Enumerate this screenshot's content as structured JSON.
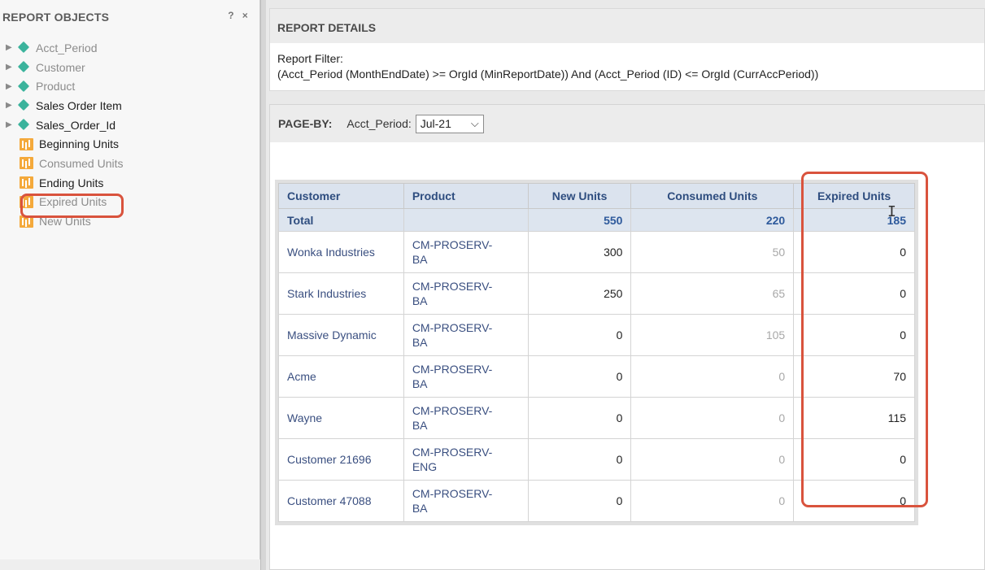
{
  "left_panel": {
    "title": "REPORT OBJECTS",
    "help_label": "?",
    "close_label": "×",
    "attributes": [
      {
        "label": "Acct_Period",
        "style": "light"
      },
      {
        "label": "Customer",
        "style": "light"
      },
      {
        "label": "Product",
        "style": "light"
      },
      {
        "label": "Sales Order Item",
        "style": "dark"
      },
      {
        "label": "Sales_Order_Id",
        "style": "dark"
      }
    ],
    "metrics": [
      {
        "label": "Beginning Units",
        "style": "dark"
      },
      {
        "label": "Consumed Units",
        "style": "light"
      },
      {
        "label": "Ending Units",
        "style": "dark"
      },
      {
        "label": "Expired Units",
        "style": "light"
      },
      {
        "label": "New Units",
        "style": "light"
      }
    ]
  },
  "details": {
    "title": "REPORT DETAILS",
    "filter_label": "Report Filter:",
    "filter_text": "(Acct_Period (MonthEndDate) >= OrgId (MinReportDate)) And (Acct_Period (ID) <= OrgId (CurrAccPeriod))"
  },
  "pageby": {
    "label": "PAGE-BY:",
    "field": "Acct_Period:",
    "selected": "Jul-21"
  },
  "grid": {
    "headers": [
      "Customer",
      "Product",
      "New Units",
      "Consumed Units",
      "Expired Units"
    ],
    "total": {
      "label": "Total",
      "new_units": "550",
      "consumed_units": "220",
      "expired_units": "185"
    },
    "rows": [
      {
        "customer": "Wonka Industries",
        "product_line1": "CM-PROSERV-",
        "product_line2": "BA",
        "new_units": "300",
        "consumed_units": "50",
        "expired_units": "0"
      },
      {
        "customer": "Stark Industries",
        "product_line1": "CM-PROSERV-",
        "product_line2": "BA",
        "new_units": "250",
        "consumed_units": "65",
        "expired_units": "0"
      },
      {
        "customer": "Massive Dynamic",
        "product_line1": "CM-PROSERV-",
        "product_line2": "BA",
        "new_units": "0",
        "consumed_units": "105",
        "expired_units": "0"
      },
      {
        "customer": "Acme",
        "product_line1": "CM-PROSERV-",
        "product_line2": "BA",
        "new_units": "0",
        "consumed_units": "0",
        "expired_units": "70"
      },
      {
        "customer": "Wayne",
        "product_line1": "CM-PROSERV-",
        "product_line2": "BA",
        "new_units": "0",
        "consumed_units": "0",
        "expired_units": "115"
      },
      {
        "customer": "Customer 21696",
        "product_line1": "CM-PROSERV-",
        "product_line2": "ENG",
        "new_units": "0",
        "consumed_units": "0",
        "expired_units": "0"
      },
      {
        "customer": "Customer 47088",
        "product_line1": "CM-PROSERV-",
        "product_line2": "BA",
        "new_units": "0",
        "consumed_units": "0",
        "expired_units": "0"
      }
    ]
  },
  "colors": {
    "highlight": "#d9533d",
    "attribute_icon": "#3bb39c",
    "metric_icon": "#f4a93b",
    "header_text": "#2e4d7f"
  },
  "icons": {
    "attribute": "diamond-attribute-icon",
    "metric": "metric-chart-icon",
    "expand": "expand-arrow-icon",
    "dropdown": "chevron-down-icon",
    "cursor": "text-cursor-icon"
  }
}
